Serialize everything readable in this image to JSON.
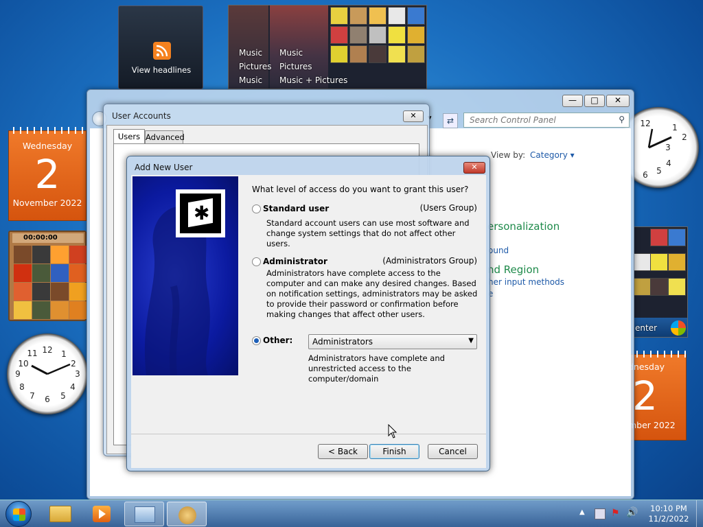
{
  "gadgets": {
    "rss": {
      "label": "View headlines"
    },
    "media_center": {
      "labels": [
        "Music",
        "Pictures",
        "Music"
      ],
      "labels_full": [
        "Music",
        "Pictures",
        "Music + Pictures"
      ]
    },
    "calendar_left": {
      "weekday": "Wednesday",
      "day": "2",
      "month_year": "November 2022"
    },
    "calendar_right": {
      "weekday": "dnesday",
      "day": "2",
      "month_year": "mber 2022"
    },
    "puzzle": {
      "timer": "00:00:00"
    },
    "media_center_right": {
      "label": "enter"
    }
  },
  "control_panel": {
    "search_placeholder": "Search Control Panel",
    "view_by_label": "View by:",
    "view_by_value": "Category",
    "links": [
      "ersonalization",
      "ound",
      "nd Region",
      "her input methods",
      "e"
    ]
  },
  "user_accounts": {
    "title": "User Accounts",
    "tabs": [
      "Users",
      "Advanced"
    ]
  },
  "dialog": {
    "title": "Add New User",
    "question": "What level of access do you want to grant this user?",
    "options": [
      {
        "label": "Standard user",
        "group": "(Users Group)",
        "desc": "Standard account users can use most software and change system settings that do not affect other users.",
        "selected": false
      },
      {
        "label": "Administrator",
        "group": "(Administrators Group)",
        "desc": "Administrators have complete access to the computer and can make any desired changes. Based on notification settings, administrators may be asked to provide their password or confirmation before making changes that affect other users.",
        "selected": false
      },
      {
        "label": "Other:",
        "selected": true
      }
    ],
    "other_select_value": "Administrators",
    "other_desc": "Administrators have complete and unrestricted access to the computer/domain",
    "buttons": {
      "back": "< Back",
      "finish": "Finish",
      "cancel": "Cancel"
    }
  },
  "taskbar": {
    "time": "10:10 PM",
    "date": "11/2/2022"
  }
}
